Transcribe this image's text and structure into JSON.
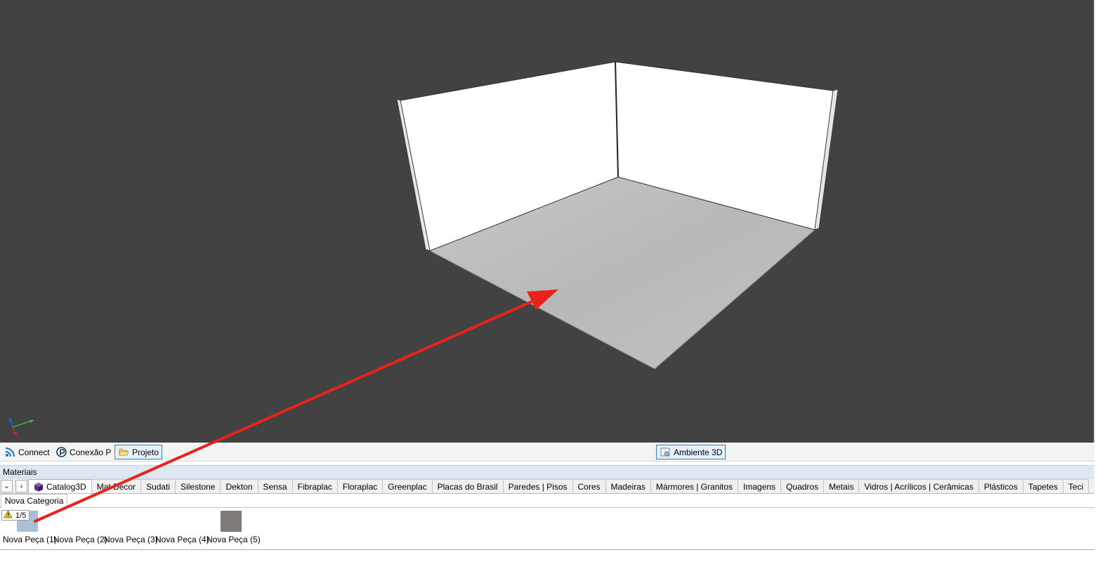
{
  "toolbar": {
    "connect_label": "Connect",
    "conexao_label": "Conexão P",
    "projeto_label": "Projeto",
    "ambiente_label": "Ambiente 3D"
  },
  "materials": {
    "header": "Materiais",
    "tabs": [
      {
        "label": "Catalog3D",
        "icon": "catalog-cube-icon"
      },
      {
        "label": "Mat Decor"
      },
      {
        "label": "Sudati"
      },
      {
        "label": "Silestone"
      },
      {
        "label": "Dekton"
      },
      {
        "label": "Sensa"
      },
      {
        "label": "Fibraplac"
      },
      {
        "label": "Floraplac"
      },
      {
        "label": "Greenplac"
      },
      {
        "label": "Placas do Brasil"
      },
      {
        "label": "Paredes | Pisos"
      },
      {
        "label": "Cores"
      },
      {
        "label": "Madeiras"
      },
      {
        "label": "Mármores | Granitos"
      },
      {
        "label": "Imagens"
      },
      {
        "label": "Quadros"
      },
      {
        "label": "Metais"
      },
      {
        "label": "Vidros | Acrílicos | Cerâmicas"
      },
      {
        "label": "Plásticos"
      },
      {
        "label": "Tapetes"
      },
      {
        "label": "Teci"
      }
    ],
    "category": "Nova Categoria",
    "warning_count": "1/5",
    "items": [
      {
        "label": "Nova Peça (1)",
        "color": "#a9bfd3"
      },
      {
        "label": "Nova Peça (2)",
        "color": ""
      },
      {
        "label": "Nova Peça (3)",
        "color": ""
      },
      {
        "label": "Nova Peça (4)",
        "color": ""
      },
      {
        "label": "Nova Peça (5)",
        "color": "#7e7a75"
      }
    ]
  },
  "colors": {
    "viewport_bg": "#424242",
    "annotation_arrow": "#e8231c",
    "floor": "#bdbdbd",
    "wall": "#ffffff",
    "catalog_cube": "#5a2d82"
  }
}
